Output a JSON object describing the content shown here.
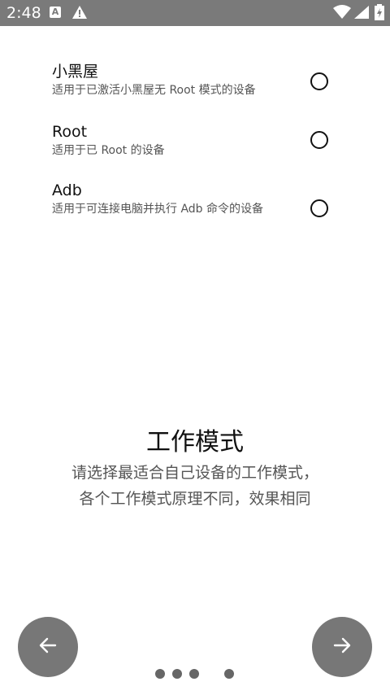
{
  "status_bar": {
    "time": "2:48",
    "notification_icons": [
      "a-app-icon",
      "warning-icon"
    ],
    "system_icons": [
      "wifi-icon",
      "signal-icon",
      "battery-charging-icon"
    ]
  },
  "options": [
    {
      "title": "小黑屋",
      "description": "适用于已激活小黑屋无 Root 模式的设备"
    },
    {
      "title": "Root",
      "description": "适用于已 Root 的设备"
    },
    {
      "title": "Adb",
      "description": "适用于可连接电脑并执行 Adb 命令的设备"
    }
  ],
  "mode": {
    "title": "工作模式",
    "description_line1": "请选择最适合自己设备的工作模式，",
    "description_line2": "各个工作模式原理不同，效果相同"
  },
  "navigation": {
    "prev_icon": "arrow-left-icon",
    "next_icon": "arrow-right-icon",
    "page_count": 4
  }
}
